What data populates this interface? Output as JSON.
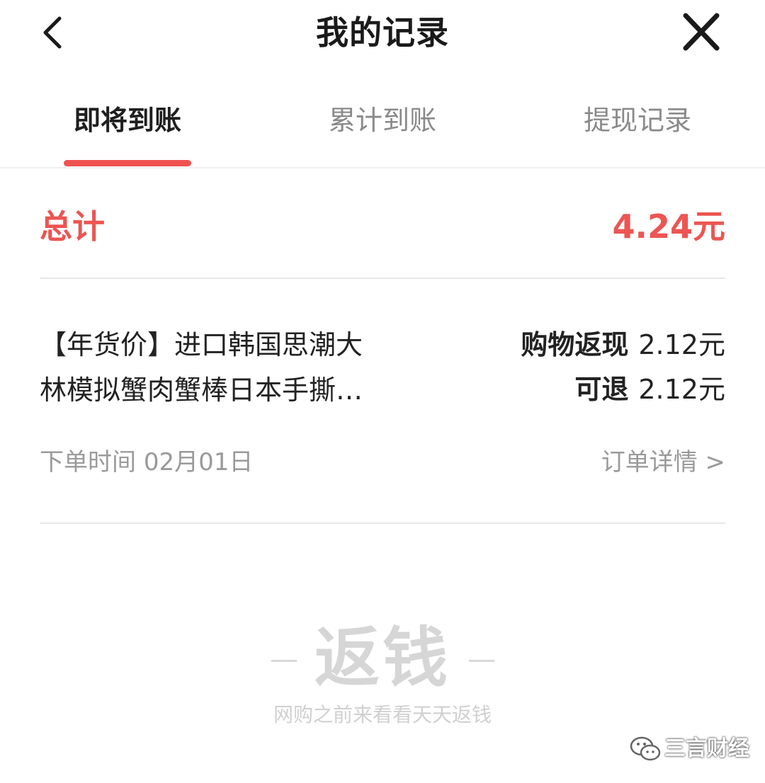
{
  "header": {
    "title": "我的记录",
    "back_icon": "chevron-left-icon",
    "close_icon": "close-icon"
  },
  "tabs": [
    {
      "label": "即将到账",
      "active": true
    },
    {
      "label": "累计到账",
      "active": false
    },
    {
      "label": "提现记录",
      "active": false
    }
  ],
  "accent_color": "#ec5552",
  "summary": {
    "label": "总计",
    "value": "4.24元"
  },
  "records": [
    {
      "product_name": "【年货价】进口韩国思潮大\n林模拟蟹肉蟹棒日本手撕…",
      "cashback_label": "购物返现",
      "cashback_value": "2.12元",
      "refundable_label": "可退",
      "refundable_value": "2.12元",
      "order_time_label": "下单时间",
      "order_time_value": "02月01日",
      "detail_link": "订单详情 >"
    }
  ],
  "brand": {
    "logo_text": "返钱",
    "slogan": "网购之前来看看天天返钱"
  },
  "watermark": {
    "text": "三言财经",
    "icon": "wechat-icon"
  }
}
